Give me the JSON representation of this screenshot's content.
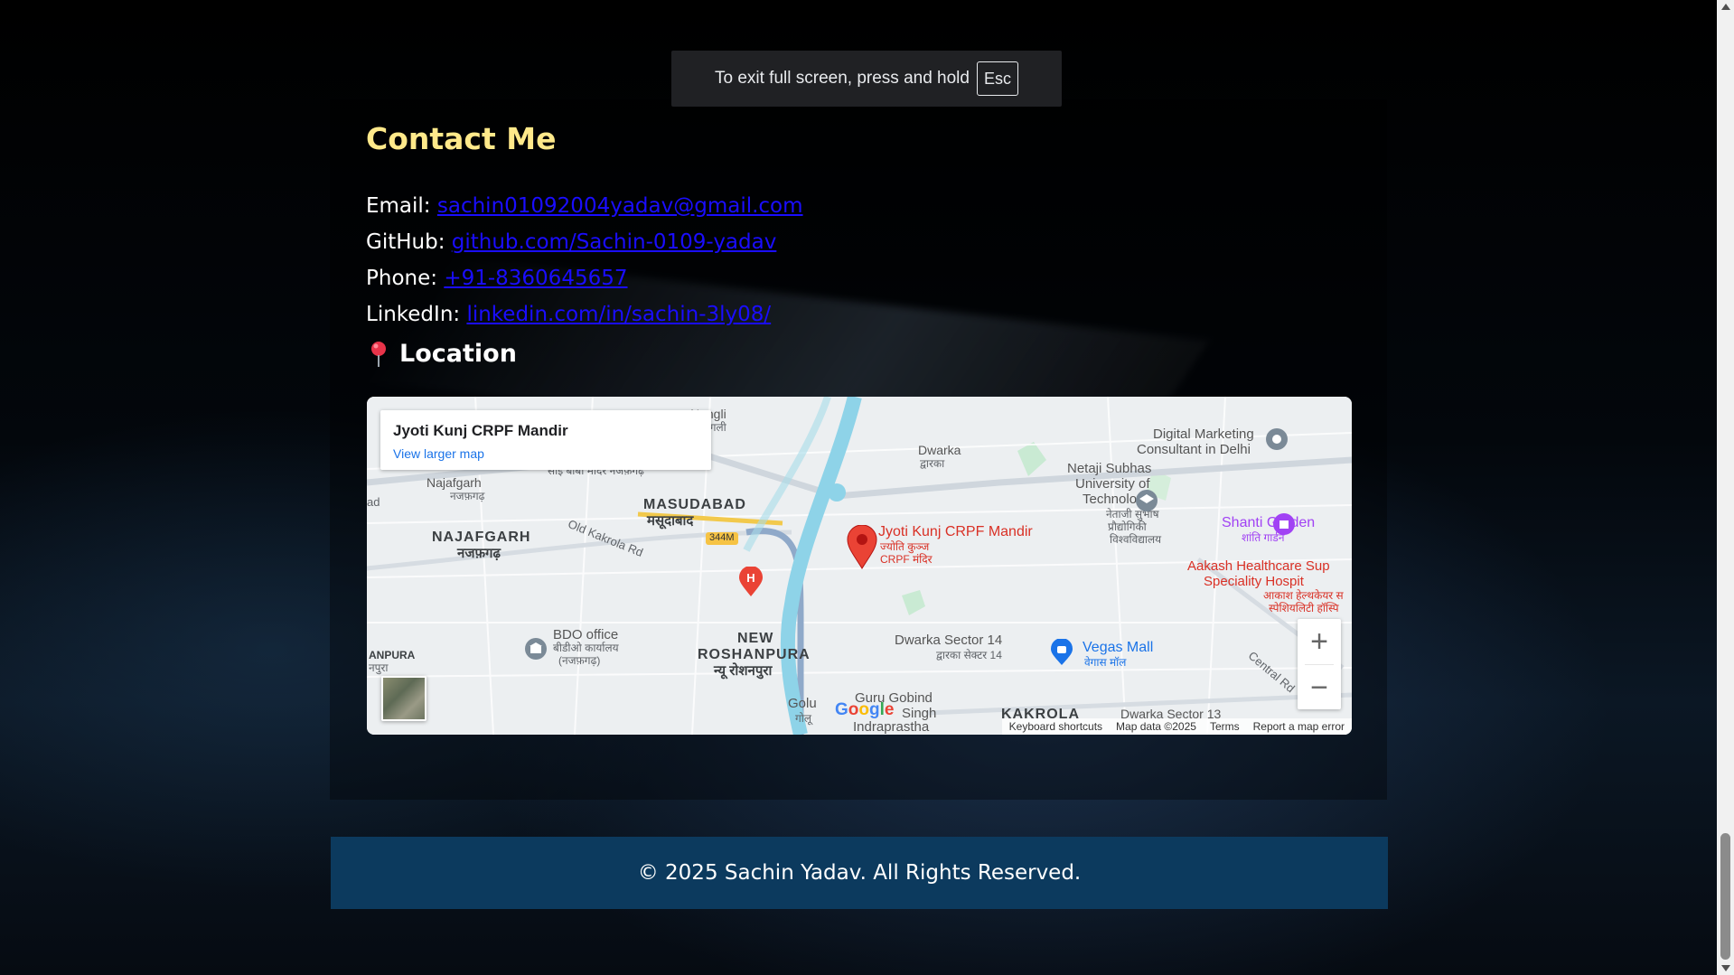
{
  "fullscreen_toast": {
    "text": "To exit full screen, press and hold",
    "key": "Esc"
  },
  "contact": {
    "title": "Contact Me",
    "items": [
      {
        "label": "Email:",
        "value": "sachin01092004yadav@gmail.com"
      },
      {
        "label": "GitHub:",
        "value": "github.com/Sachin-0109-yadav"
      },
      {
        "label": "Phone:",
        "value": "+91-8360645657"
      },
      {
        "label": "LinkedIn:",
        "value": "linkedin.com/in/sachin-3ly08/"
      }
    ]
  },
  "location": {
    "heading": "Location",
    "pin_icon": "round-pushpin-icon"
  },
  "map": {
    "place_name": "Jyoti Kunj CRPF Mandir",
    "view_larger": "View larger map",
    "marker_label": "Jyoti Kunj CRPF Mandir",
    "marker_label_hi": "ज्योति कुञ्ज",
    "marker_label_hi2": "CRPF मंदिर",
    "labels": {
      "nangli": "Nangli",
      "nangli_hi": "नांगली",
      "dwarka": "Dwarka",
      "dwarka_hi": "द्वारका",
      "digital": "Digital Marketing",
      "digital2": "Consultant in Delhi",
      "najafgarh_small": "Najafgarh",
      "najafgarh_small_hi": "नजफ़गढ़",
      "sai_baba": "साई बाबा मंदिर नजफ़गढ़",
      "masudabad": "MASUDABAD",
      "masudabad_hi": "मसूदाबाद",
      "netaji1": "Netaji Subhas",
      "netaji2": "University of",
      "netaji3": "Technology",
      "netaji_hi1": "नेताजी सुभाष",
      "netaji_hi2": "प्रौद्योगिकी",
      "netaji_hi3": "विश्वविद्यालय",
      "shanti": "Shanti Garden",
      "shanti_hi": "शांति गार्डन",
      "najafgarh_big": "NAJAFGARH",
      "najafgarh_big_hi": "नजफ़गढ़",
      "old_kakrola": "Old Kakrola Rd",
      "road_344m": "344M",
      "aakash1": "Aakash Healthcare Sup",
      "aakash2": "Speciality Hospit",
      "aakash_hi1": "आकाश हेल्थकेयर स",
      "aakash_hi2": "स्पेशियलिटी हॉस्पि",
      "bdo": "BDO office",
      "bdo_hi1": "बीडीओ कार्यालय",
      "bdo_hi2": "(नजफ़गढ़)",
      "new_roshanpura1": "NEW",
      "new_roshanpura2": "ROSHANPURA",
      "new_roshanpura_hi": "न्यू रोशनपुरा",
      "dwarka14": "Dwarka Sector 14",
      "dwarka14_hi": "द्वारका सेक्टर 14",
      "vegas": "Vegas Mall",
      "vegas_hi": "वेगास मॉल",
      "central_rd": "Central Rd",
      "anpura": "ANPURA",
      "anpura_hi": "नपुरा",
      "golu": "Golu",
      "golu_hi": "गोलू",
      "guru1": "Guru Gobind",
      "guru2": "Singh",
      "guru3": "Indraprastha",
      "kakrola": "KAKROLA",
      "dwarka13": "Dwarka Sector 13",
      "ad": "ad"
    },
    "attribution": {
      "shortcuts": "Keyboard shortcuts",
      "data": "Map data ©2025",
      "terms": "Terms",
      "report": "Report a map error"
    },
    "logo": {
      "g1": "G",
      "o1": "o",
      "o2": "o",
      "g2": "g",
      "l": "l",
      "e": "e"
    },
    "zoom_in": "+",
    "zoom_out": "−"
  },
  "footer": {
    "text": "© 2025 Sachin Yadav. All Rights Reserved."
  },
  "colors": {
    "title": "#ffe98a",
    "link": "#1a0dff",
    "footer_bg": "#0c3a5e",
    "marker": "#ea4335"
  }
}
